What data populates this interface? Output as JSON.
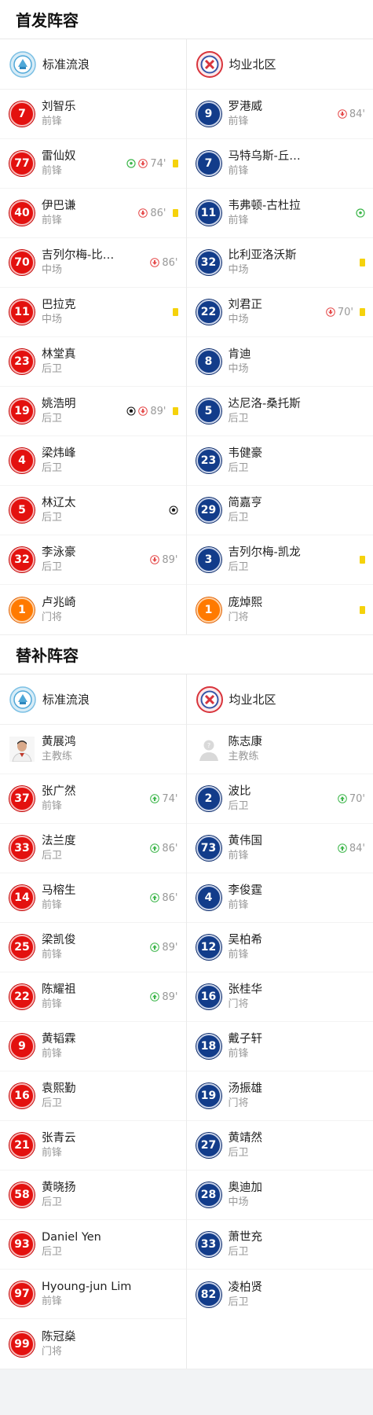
{
  "starting": {
    "title": "首发阵容",
    "home": {
      "name": "标准流浪",
      "players": [
        {
          "num": "7",
          "name": "刘智乐",
          "pos": "前锋",
          "kind": "home",
          "events": []
        },
        {
          "num": "77",
          "name": "雷仙奴",
          "pos": "前锋",
          "kind": "home",
          "events": [
            {
              "t": "assist"
            },
            {
              "t": "off",
              "min": "74'"
            },
            {
              "t": "yellow"
            }
          ]
        },
        {
          "num": "40",
          "name": "伊巴谦",
          "pos": "前锋",
          "kind": "home",
          "events": [
            {
              "t": "off",
              "min": "86'"
            },
            {
              "t": "yellow"
            }
          ]
        },
        {
          "num": "70",
          "name": "吉列尔梅-比…",
          "pos": "中场",
          "kind": "home",
          "events": [
            {
              "t": "off",
              "min": "86'"
            }
          ]
        },
        {
          "num": "11",
          "name": "巴拉克",
          "pos": "中场",
          "kind": "home",
          "events": [
            {
              "t": "yellow"
            }
          ]
        },
        {
          "num": "23",
          "name": "林堂真",
          "pos": "后卫",
          "kind": "home",
          "events": []
        },
        {
          "num": "19",
          "name": "姚浩明",
          "pos": "后卫",
          "kind": "home",
          "events": [
            {
              "t": "goal"
            },
            {
              "t": "off",
              "min": "89'"
            },
            {
              "t": "yellow"
            }
          ]
        },
        {
          "num": "4",
          "name": "梁炜峰",
          "pos": "后卫",
          "kind": "home",
          "events": []
        },
        {
          "num": "5",
          "name": "林辽太",
          "pos": "后卫",
          "kind": "home",
          "events": [
            {
              "t": "goal"
            }
          ]
        },
        {
          "num": "32",
          "name": "李泳豪",
          "pos": "后卫",
          "kind": "home",
          "events": [
            {
              "t": "off",
              "min": "89'"
            }
          ]
        },
        {
          "num": "1",
          "name": "卢兆崎",
          "pos": "门将",
          "kind": "gk",
          "events": []
        }
      ]
    },
    "away": {
      "name": "均业北区",
      "players": [
        {
          "num": "9",
          "name": "罗港威",
          "pos": "前锋",
          "kind": "away",
          "events": [
            {
              "t": "off",
              "min": "84'"
            }
          ]
        },
        {
          "num": "7",
          "name": "马特乌斯-丘…",
          "pos": "前锋",
          "kind": "away",
          "events": []
        },
        {
          "num": "11",
          "name": "韦弗顿-古杜拉",
          "pos": "前锋",
          "kind": "away",
          "events": [
            {
              "t": "assist"
            }
          ]
        },
        {
          "num": "32",
          "name": "比利亚洛沃斯",
          "pos": "中场",
          "kind": "away",
          "events": [
            {
              "t": "yellow"
            }
          ]
        },
        {
          "num": "22",
          "name": "刘君正",
          "pos": "中场",
          "kind": "away",
          "events": [
            {
              "t": "off",
              "min": "70'"
            },
            {
              "t": "yellow"
            }
          ]
        },
        {
          "num": "8",
          "name": "肯迪",
          "pos": "中场",
          "kind": "away",
          "events": []
        },
        {
          "num": "5",
          "name": "达尼洛-桑托斯",
          "pos": "后卫",
          "kind": "away",
          "events": []
        },
        {
          "num": "23",
          "name": "韦健豪",
          "pos": "后卫",
          "kind": "away",
          "events": []
        },
        {
          "num": "29",
          "name": "简嘉亨",
          "pos": "后卫",
          "kind": "away",
          "events": []
        },
        {
          "num": "3",
          "name": "吉列尔梅-凯龙",
          "pos": "后卫",
          "kind": "away",
          "events": [
            {
              "t": "yellow"
            }
          ]
        },
        {
          "num": "1",
          "name": "庞焯熙",
          "pos": "门将",
          "kind": "gk",
          "events": [
            {
              "t": "yellow"
            }
          ]
        }
      ]
    }
  },
  "subs": {
    "title": "替补阵容",
    "home": {
      "name": "标准流浪",
      "players": [
        {
          "num": "",
          "name": "黄展鸿",
          "pos": "主教练",
          "kind": "coach-photo",
          "events": []
        },
        {
          "num": "37",
          "name": "张广然",
          "pos": "前锋",
          "kind": "home",
          "events": [
            {
              "t": "on",
              "min": "74'"
            }
          ]
        },
        {
          "num": "33",
          "name": "法兰度",
          "pos": "后卫",
          "kind": "home",
          "events": [
            {
              "t": "on",
              "min": "86'"
            }
          ]
        },
        {
          "num": "14",
          "name": "马榕生",
          "pos": "前锋",
          "kind": "home",
          "events": [
            {
              "t": "on",
              "min": "86'"
            }
          ]
        },
        {
          "num": "25",
          "name": "梁凯俊",
          "pos": "前锋",
          "kind": "home",
          "events": [
            {
              "t": "on",
              "min": "89'"
            }
          ]
        },
        {
          "num": "22",
          "name": "陈耀祖",
          "pos": "前锋",
          "kind": "home",
          "events": [
            {
              "t": "on",
              "min": "89'"
            }
          ]
        },
        {
          "num": "9",
          "name": "黄韬霖",
          "pos": "前锋",
          "kind": "home",
          "events": []
        },
        {
          "num": "16",
          "name": "袁熙勤",
          "pos": "后卫",
          "kind": "home",
          "events": []
        },
        {
          "num": "21",
          "name": "张青云",
          "pos": "前锋",
          "kind": "home",
          "events": []
        },
        {
          "num": "58",
          "name": "黄晓扬",
          "pos": "后卫",
          "kind": "home",
          "events": []
        },
        {
          "num": "93",
          "name": "Daniel Yen",
          "pos": "后卫",
          "kind": "home",
          "events": []
        },
        {
          "num": "97",
          "name": "Hyoung-jun Lim",
          "pos": "前锋",
          "kind": "home",
          "events": []
        },
        {
          "num": "99",
          "name": "陈冠燊",
          "pos": "门将",
          "kind": "home",
          "events": []
        }
      ]
    },
    "away": {
      "name": "均业北区",
      "players": [
        {
          "num": "",
          "name": "陈志康",
          "pos": "主教练",
          "kind": "coach-blank",
          "events": []
        },
        {
          "num": "2",
          "name": "波比",
          "pos": "后卫",
          "kind": "away",
          "events": [
            {
              "t": "on",
              "min": "70'"
            }
          ]
        },
        {
          "num": "73",
          "name": "黄伟国",
          "pos": "前锋",
          "kind": "away",
          "events": [
            {
              "t": "on",
              "min": "84'"
            }
          ]
        },
        {
          "num": "4",
          "name": "李俊霆",
          "pos": "前锋",
          "kind": "away",
          "events": []
        },
        {
          "num": "12",
          "name": "吴柏希",
          "pos": "前锋",
          "kind": "away",
          "events": []
        },
        {
          "num": "16",
          "name": "张桂华",
          "pos": "门将",
          "kind": "away",
          "events": []
        },
        {
          "num": "18",
          "name": "戴子轩",
          "pos": "前锋",
          "kind": "away",
          "events": []
        },
        {
          "num": "19",
          "name": "汤振雄",
          "pos": "门将",
          "kind": "away",
          "events": []
        },
        {
          "num": "27",
          "name": "黄靖然",
          "pos": "后卫",
          "kind": "away",
          "events": []
        },
        {
          "num": "28",
          "name": "奥迪加",
          "pos": "中场",
          "kind": "away",
          "events": []
        },
        {
          "num": "33",
          "name": "萧世充",
          "pos": "后卫",
          "kind": "away",
          "events": []
        },
        {
          "num": "82",
          "name": "凌柏贤",
          "pos": "后卫",
          "kind": "away",
          "events": []
        }
      ]
    }
  },
  "colors": {
    "home_number": "#e3110f",
    "away_number": "#123c8a",
    "goalkeeper_number": "#ff7a00",
    "yellow_card": "#f5d20c",
    "sub_off": "#e54b4b",
    "sub_on": "#3cb64a"
  }
}
